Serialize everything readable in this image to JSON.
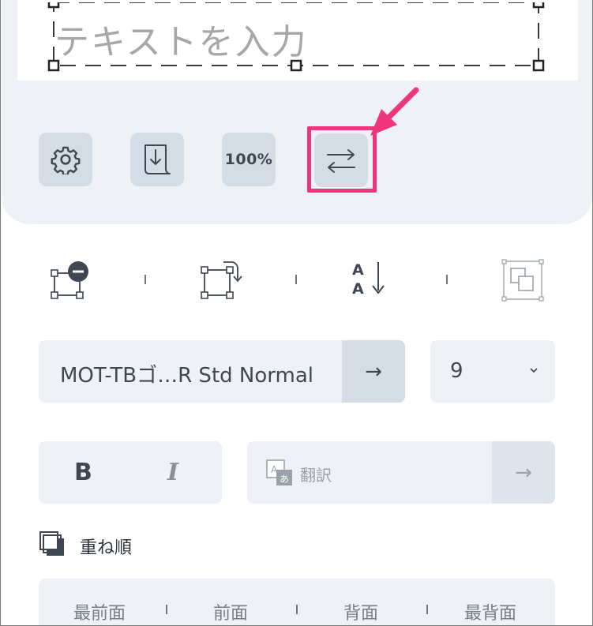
{
  "canvas": {
    "placeholder": "テキストを入力"
  },
  "toolbar": {
    "settings_icon": "gear-icon",
    "download_icon": "download-icon",
    "zoom_label": "100%",
    "swap_icon": "swap-arrows-icon",
    "highlight_color": "#f0357a"
  },
  "transform": {
    "icons": [
      "remove-frame-icon",
      "rotate-frame-icon",
      "text-direction-icon",
      "layer-overlap-icon"
    ]
  },
  "font": {
    "name": "MOT-TBゴ…R Std Normal",
    "go_arrow": "→",
    "size": "9"
  },
  "style": {
    "bold": "B",
    "italic": "I",
    "translate_label": "翻訳",
    "translate_arrow": "→"
  },
  "order": {
    "title": "重ね順",
    "items": [
      "最前面",
      "前面",
      "背面",
      "最背面"
    ]
  },
  "colors": {
    "panel_bg": "#eef2f6",
    "button_bg": "#d4dde6",
    "text": "#3f4753",
    "accent": "#f0357a"
  }
}
